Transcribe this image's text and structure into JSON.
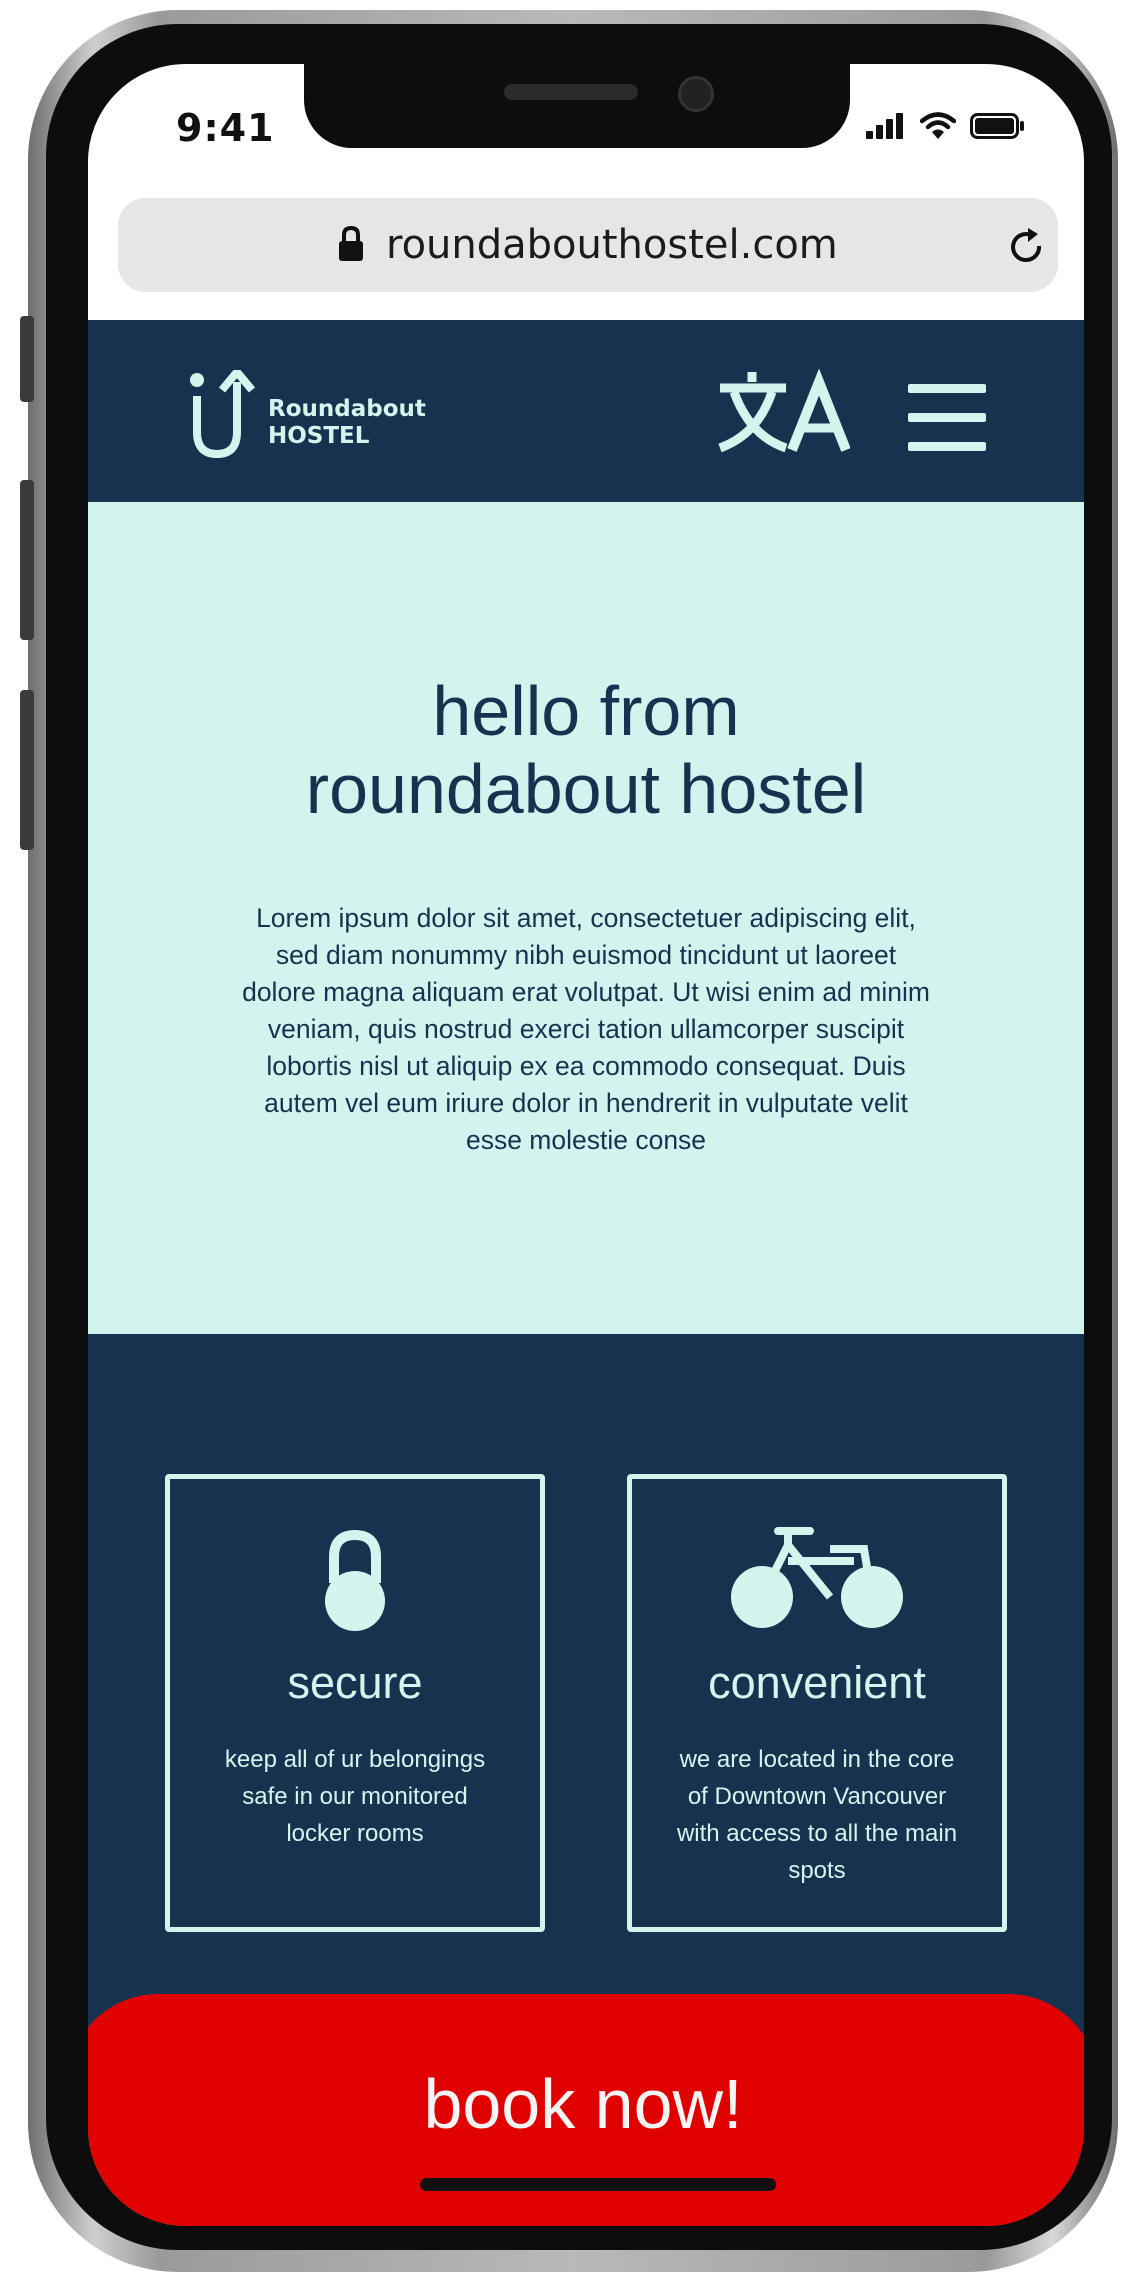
{
  "status_bar": {
    "time": "9:41"
  },
  "browser": {
    "url": "roundabouthostel.com"
  },
  "nav": {
    "logo_line1": "Roundabout",
    "logo_line2": "HOSTEL"
  },
  "hero": {
    "title_line1": "hello from",
    "title_line2": "roundabout hostel",
    "body": "Lorem ipsum dolor sit amet, consectetuer adipiscing elit, sed diam nonummy nibh euismod tincidunt ut laoreet dolore magna aliquam erat volutpat. Ut wisi enim ad minim veniam, quis nostrud exerci tation ullamcorper suscipit lobortis nisl ut aliquip ex ea commodo consequat. Duis autem vel eum iriure dolor in hendrerit in vulputate velit esse molestie conse"
  },
  "features": [
    {
      "icon": "lock-icon",
      "title": "secure",
      "desc": "keep all of ur belongings safe in our monitored locker rooms"
    },
    {
      "icon": "bicycle-icon",
      "title": "convenient",
      "desc": "we are located in the core of Downtown Vancouver with access to all the main spots"
    }
  ],
  "cta": {
    "label": "book now!"
  },
  "colors": {
    "navy": "#17324f",
    "mint": "#d2f4ef",
    "red": "#e10000"
  }
}
